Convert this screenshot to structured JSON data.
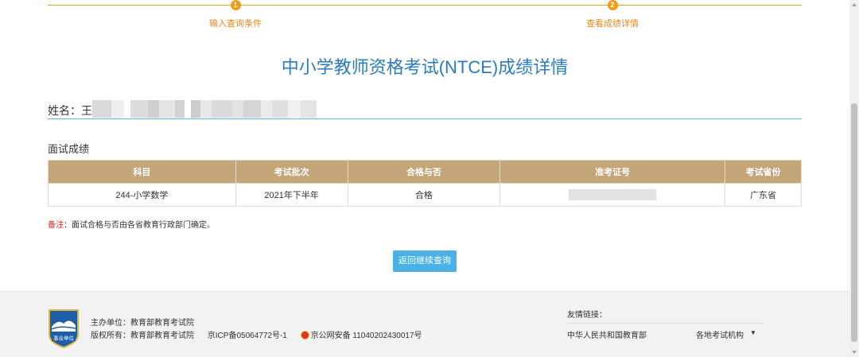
{
  "steps": [
    {
      "num": "1",
      "label": "输入查询条件"
    },
    {
      "num": "2",
      "label": "查看成绩详情"
    }
  ],
  "page_title": "中小学教师资格考试(NTCE)成绩详情",
  "name": {
    "label": "姓名：王",
    "value_redacted": true
  },
  "section_title": "面试成绩",
  "table": {
    "headers": [
      "科目",
      "考试批次",
      "合格与否",
      "准考证号",
      "考试省份"
    ],
    "rows": [
      [
        "244-小学数学",
        "2021年下半年",
        "合格",
        "",
        "广东省"
      ]
    ]
  },
  "remark": {
    "key": "备注",
    "text": "：面试合格与否由各省教育行政部门确定。"
  },
  "back_button": "返回继续查询",
  "footer": {
    "badge_text": "事业单位",
    "host_label": "主办单位：教育部教育考试院",
    "copyright_label": "版权所有：教育部教育考试院",
    "icp": "京ICP备05064772号-1",
    "police": "京公网安备 11040202430017号",
    "links_title": "友情链接：",
    "link1": "中华人民共和国教育部",
    "link2": "各地考试机构",
    "link2_arrow": "▼"
  },
  "colors": {
    "accent_orange": "#f29b1a",
    "title_blue": "#2a7bbf",
    "table_header": "#c3a57a",
    "button_blue": "#4ab0e6",
    "remark_red": "#e0231a"
  }
}
